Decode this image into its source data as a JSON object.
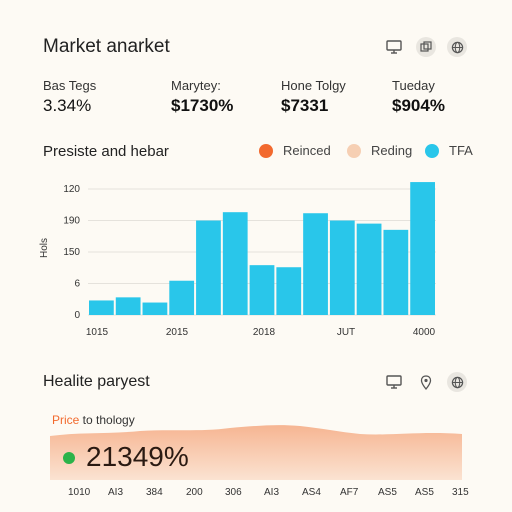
{
  "header": {
    "title": "Market anarket",
    "icons": [
      "monitor-icon",
      "copy-icon",
      "globe-icon"
    ]
  },
  "stats": [
    {
      "label": "Bas Tegs",
      "value": "3.34%"
    },
    {
      "label": "Marytey:",
      "value": "$1730%"
    },
    {
      "label": "Hone Tolgy",
      "value": "$7331"
    },
    {
      "label": "Tueday",
      "value": "$904%"
    }
  ],
  "chart_section": {
    "title": "Presiste and hebar",
    "legend": [
      {
        "name": "Reinced",
        "color": "#f2692e"
      },
      {
        "name": "Reding",
        "color": "#f6cfb3"
      },
      {
        "name": "TFA",
        "color": "#29c6ea"
      }
    ]
  },
  "chart_data": {
    "type": "bar",
    "ylabel": "Hols",
    "y_ticks": [
      "120",
      "190",
      "150",
      "6",
      "0"
    ],
    "x_ticks": [
      "1015",
      "2015",
      "2018",
      "JUT",
      "4000"
    ],
    "values": [
      14,
      17,
      12,
      33,
      91,
      99,
      48,
      46,
      98,
      91,
      88,
      82,
      128
    ],
    "bar_color": "#29c6ea"
  },
  "health_section": {
    "title": "Healite paryest",
    "icons": [
      "monitor-icon",
      "pin-icon",
      "globe-icon"
    ],
    "price_label_accent": "Price",
    "price_label_rest": " to thology",
    "big_value": "21349%",
    "status_color": "#2bb34a",
    "area_color": "#f6b592",
    "x_ticks": [
      "1010",
      "AI3",
      "384",
      "200",
      "306",
      "AI3",
      "AS4",
      "AF7",
      "AS5",
      "AS5",
      "315"
    ]
  }
}
